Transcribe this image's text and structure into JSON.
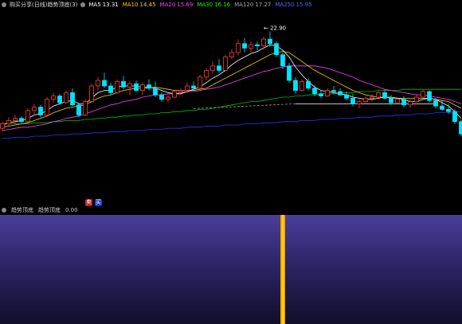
{
  "header": {
    "title": "购买分享(日线)趋势顶底(3)",
    "ma": [
      {
        "name": "MA5",
        "value": "13.31",
        "color": "#ffffff"
      },
      {
        "name": "MA10",
        "value": "14.45",
        "color": "#ffd000"
      },
      {
        "name": "MA20",
        "value": "15.69",
        "color": "#ff40ff"
      },
      {
        "name": "MA30",
        "value": "16.16",
        "color": "#00ff00"
      },
      {
        "name": "MA120",
        "value": "17.27",
        "color": "#aaaaaa"
      },
      {
        "name": "MA250",
        "value": "15.95",
        "color": "#6060ff"
      }
    ]
  },
  "markers": {
    "peak_label": "← 22.90",
    "sell_tag": "卖",
    "buy_tag": "买"
  },
  "lower": {
    "title": "趋势顶底",
    "subtitle": "趋势顶底",
    "value": "0.00",
    "signal_index": 44
  },
  "colors": {
    "up": "#ff3a3a",
    "down": "#00e5ff",
    "ma5": "#ffffff",
    "ma10": "#ffd000",
    "ma20": "#ff40ff",
    "ma60": "#00c000",
    "ma250": "#3030ff",
    "level": "#ffffff"
  },
  "chart_data": {
    "type": "candlestick",
    "price_range": [
      7.5,
      25.0
    ],
    "candles": [
      [
        14.2,
        14.8,
        13.9,
        14.6
      ],
      [
        14.6,
        15.2,
        14.4,
        14.9
      ],
      [
        14.9,
        15.4,
        14.6,
        15.1
      ],
      [
        15.1,
        15.3,
        14.7,
        14.8
      ],
      [
        14.8,
        16.0,
        14.7,
        15.8
      ],
      [
        15.8,
        16.4,
        15.5,
        16.1
      ],
      [
        16.1,
        16.3,
        15.2,
        15.4
      ],
      [
        15.4,
        17.0,
        15.3,
        16.8
      ],
      [
        16.8,
        17.4,
        16.5,
        17.1
      ],
      [
        17.1,
        17.3,
        16.3,
        16.5
      ],
      [
        16.5,
        17.6,
        16.4,
        17.4
      ],
      [
        17.4,
        17.8,
        16.2,
        16.3
      ],
      [
        16.3,
        16.5,
        15.2,
        15.4
      ],
      [
        15.4,
        16.8,
        15.3,
        16.6
      ],
      [
        16.6,
        18.2,
        16.5,
        18.0
      ],
      [
        18.0,
        18.8,
        17.6,
        18.5
      ],
      [
        18.5,
        19.2,
        17.8,
        18.0
      ],
      [
        18.0,
        18.3,
        17.2,
        17.4
      ],
      [
        17.4,
        18.6,
        17.3,
        18.4
      ],
      [
        18.4,
        18.9,
        17.7,
        17.9
      ],
      [
        17.9,
        18.4,
        17.2,
        18.2
      ],
      [
        18.2,
        18.5,
        17.5,
        17.6
      ],
      [
        17.6,
        18.3,
        17.2,
        18.1
      ],
      [
        18.1,
        18.6,
        17.6,
        17.8
      ],
      [
        17.8,
        18.4,
        17.0,
        17.2
      ],
      [
        17.2,
        17.4,
        16.6,
        16.8
      ],
      [
        16.8,
        17.2,
        16.5,
        17.0
      ],
      [
        17.0,
        17.6,
        16.9,
        17.5
      ],
      [
        17.5,
        17.8,
        17.2,
        17.6
      ],
      [
        17.6,
        18.3,
        17.4,
        18.0
      ],
      [
        18.0,
        18.4,
        17.6,
        17.8
      ],
      [
        17.8,
        19.0,
        17.7,
        18.8
      ],
      [
        18.8,
        19.6,
        18.5,
        19.4
      ],
      [
        19.4,
        20.2,
        19.1,
        19.8
      ],
      [
        19.8,
        20.4,
        19.2,
        19.4
      ],
      [
        19.4,
        20.8,
        19.3,
        20.6
      ],
      [
        20.6,
        21.3,
        20.4,
        21.0
      ],
      [
        21.0,
        22.2,
        20.7,
        21.8
      ],
      [
        21.8,
        22.3,
        21.0,
        21.4
      ],
      [
        21.4,
        22.0,
        21.0,
        21.7
      ],
      [
        21.7,
        22.0,
        21.2,
        21.6
      ],
      [
        21.6,
        22.4,
        21.3,
        22.2
      ],
      [
        22.2,
        22.9,
        21.5,
        21.8
      ],
      [
        21.8,
        22.0,
        20.6,
        20.8
      ],
      [
        20.8,
        21.0,
        19.5,
        19.8
      ],
      [
        19.8,
        20.1,
        18.3,
        18.5
      ],
      [
        18.5,
        18.8,
        17.3,
        17.6
      ],
      [
        17.6,
        18.6,
        17.5,
        18.4
      ],
      [
        18.4,
        18.7,
        17.6,
        17.8
      ],
      [
        17.8,
        18.1,
        17.1,
        17.3
      ],
      [
        17.3,
        17.6,
        16.9,
        17.1
      ],
      [
        17.1,
        17.8,
        17.0,
        17.6
      ],
      [
        17.6,
        18.0,
        17.3,
        17.5
      ],
      [
        17.5,
        17.8,
        17.1,
        17.2
      ],
      [
        17.2,
        17.5,
        16.7,
        16.9
      ],
      [
        16.9,
        17.3,
        16.2,
        16.4
      ],
      [
        16.4,
        16.8,
        16.0,
        16.6
      ],
      [
        16.6,
        17.1,
        16.4,
        16.9
      ],
      [
        16.9,
        17.3,
        16.6,
        17.0
      ],
      [
        17.0,
        17.6,
        16.9,
        17.4
      ],
      [
        17.4,
        17.7,
        16.8,
        16.9
      ],
      [
        16.9,
        17.2,
        16.3,
        16.5
      ],
      [
        16.5,
        17.0,
        16.4,
        16.8
      ],
      [
        16.8,
        17.1,
        16.1,
        16.3
      ],
      [
        16.3,
        16.8,
        16.0,
        16.6
      ],
      [
        16.6,
        17.2,
        16.5,
        17.0
      ],
      [
        17.0,
        17.7,
        16.9,
        17.5
      ],
      [
        17.5,
        17.6,
        16.5,
        16.7
      ],
      [
        16.7,
        16.9,
        16.0,
        16.2
      ],
      [
        16.2,
        16.7,
        15.8,
        15.9
      ],
      [
        15.9,
        16.4,
        15.5,
        15.7
      ],
      [
        15.7,
        15.9,
        14.6,
        14.8
      ],
      [
        14.8,
        15.0,
        13.5,
        13.7
      ]
    ],
    "ma5": [
      14.5,
      14.7,
      14.8,
      14.9,
      15.1,
      15.4,
      15.5,
      15.8,
      16.2,
      16.4,
      16.6,
      16.7,
      16.4,
      16.4,
      16.9,
      17.4,
      17.6,
      17.6,
      17.9,
      18.0,
      18.0,
      18.0,
      17.9,
      17.9,
      17.8,
      17.6,
      17.4,
      17.3,
      17.3,
      17.5,
      17.7,
      17.9,
      18.3,
      18.7,
      19.0,
      19.4,
      19.9,
      20.3,
      20.6,
      20.9,
      21.1,
      21.4,
      21.7,
      21.6,
      21.2,
      20.6,
      19.7,
      19.0,
      18.4,
      17.9,
      17.6,
      17.5,
      17.4,
      17.3,
      17.2,
      17.0,
      16.9,
      16.8,
      16.8,
      16.9,
      17.0,
      17.0,
      16.9,
      16.8,
      16.6,
      16.6,
      16.8,
      16.9,
      16.8,
      16.5,
      16.2,
      15.7,
      15.1
    ],
    "ma10": [
      14.3,
      14.4,
      14.5,
      14.6,
      14.7,
      14.9,
      15.1,
      15.3,
      15.6,
      15.8,
      16.0,
      16.1,
      16.2,
      16.3,
      16.6,
      16.9,
      17.1,
      17.2,
      17.4,
      17.6,
      17.7,
      17.8,
      17.8,
      17.8,
      17.9,
      17.8,
      17.7,
      17.6,
      17.6,
      17.6,
      17.6,
      17.7,
      17.8,
      18.1,
      18.4,
      18.7,
      19.0,
      19.3,
      19.6,
      19.9,
      20.2,
      20.5,
      20.8,
      21.0,
      21.1,
      21.0,
      20.6,
      20.2,
      19.8,
      19.4,
      19.1,
      18.8,
      18.5,
      18.2,
      17.9,
      17.6,
      17.4,
      17.2,
      17.1,
      17.0,
      17.0,
      16.9,
      16.9,
      16.9,
      16.9,
      16.9,
      16.9,
      16.9,
      16.8,
      16.7,
      16.6,
      16.3,
      16.0
    ],
    "ma20": [
      14.0,
      14.1,
      14.2,
      14.3,
      14.3,
      14.4,
      14.5,
      14.6,
      14.8,
      14.9,
      15.1,
      15.2,
      15.3,
      15.5,
      15.7,
      15.9,
      16.1,
      16.3,
      16.4,
      16.6,
      16.7,
      16.8,
      17.0,
      17.1,
      17.2,
      17.2,
      17.3,
      17.3,
      17.4,
      17.5,
      17.5,
      17.6,
      17.7,
      17.8,
      17.9,
      18.1,
      18.3,
      18.5,
      18.7,
      18.9,
      19.1,
      19.3,
      19.4,
      19.6,
      19.7,
      19.8,
      19.8,
      19.8,
      19.8,
      19.8,
      19.7,
      19.6,
      19.4,
      19.2,
      19.0,
      18.8,
      18.5,
      18.3,
      18.1,
      17.9,
      17.7,
      17.6,
      17.5,
      17.4,
      17.3,
      17.2,
      17.2,
      17.1,
      17.0,
      16.9,
      16.8,
      16.6,
      16.4
    ],
    "ma60": [
      14.6,
      14.6,
      14.6,
      14.6,
      14.6,
      14.7,
      14.7,
      14.7,
      14.8,
      14.8,
      14.9,
      14.9,
      14.9,
      15.0,
      15.0,
      15.1,
      15.1,
      15.2,
      15.2,
      15.3,
      15.3,
      15.4,
      15.4,
      15.5,
      15.5,
      15.6,
      15.6,
      15.7,
      15.7,
      15.8,
      15.8,
      15.9,
      15.9,
      16.0,
      16.1,
      16.2,
      16.3,
      16.4,
      16.5,
      16.6,
      16.6,
      16.7,
      16.8,
      16.9,
      17.0,
      17.0,
      17.1,
      17.1,
      17.2,
      17.2,
      17.3,
      17.3,
      17.3,
      17.4,
      17.4,
      17.4,
      17.5,
      17.5,
      17.5,
      17.6,
      17.6,
      17.6,
      17.6,
      17.7,
      17.7,
      17.7,
      17.7,
      17.7,
      17.7,
      17.7,
      17.7,
      17.7,
      17.7
    ],
    "ma250": [
      13.3,
      13.3,
      13.4,
      13.4,
      13.4,
      13.5,
      13.5,
      13.5,
      13.6,
      13.6,
      13.6,
      13.7,
      13.7,
      13.7,
      13.8,
      13.8,
      13.8,
      13.9,
      13.9,
      13.9,
      14.0,
      14.0,
      14.0,
      14.1,
      14.1,
      14.1,
      14.2,
      14.2,
      14.2,
      14.3,
      14.3,
      14.3,
      14.4,
      14.4,
      14.4,
      14.5,
      14.5,
      14.5,
      14.6,
      14.6,
      14.6,
      14.7,
      14.7,
      14.7,
      14.8,
      14.8,
      14.8,
      14.9,
      14.9,
      14.9,
      15.0,
      15.0,
      15.0,
      15.1,
      15.1,
      15.1,
      15.2,
      15.2,
      15.2,
      15.3,
      15.3,
      15.3,
      15.4,
      15.4,
      15.4,
      15.5,
      15.5,
      15.5,
      15.6,
      15.6,
      15.6,
      15.7,
      15.7
    ],
    "support_level": 16.4,
    "peak_value": 22.9,
    "peak_index": 42
  }
}
